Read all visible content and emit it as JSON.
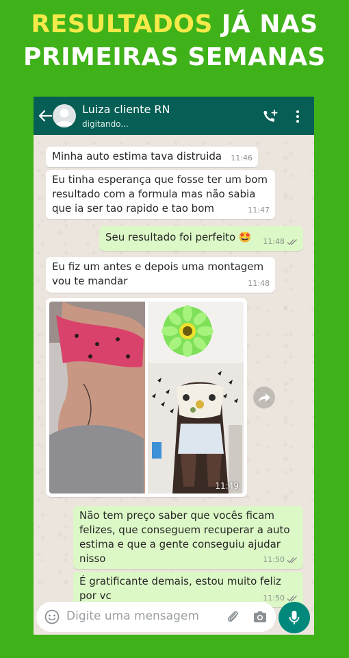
{
  "headline": {
    "accent": "RESULTADOS",
    "line1_rest": " JÁ NAS",
    "line2": "PRIMEIRAS SEMANAS"
  },
  "header": {
    "contact_name": "Luiza cliente RN",
    "status": "digitando...",
    "icons": [
      "back-arrow-icon",
      "avatar",
      "add-call-icon",
      "more-vert-icon"
    ]
  },
  "messages": [
    {
      "direction": "in",
      "text": "Minha auto estima tava distruida",
      "time": "11:46"
    },
    {
      "direction": "in",
      "text": "Eu tinha esperança que fosse ter um bom\nresultado com a formula mas não sabia\nque ia ser tao rapido e tao bom",
      "time": "11:47"
    },
    {
      "direction": "out",
      "text": "Seu resultado foi perfeito 🤩",
      "time": "11:48",
      "read": true
    },
    {
      "direction": "in",
      "text": "Eu fiz um antes e depois uma montagem\nvou te mandar",
      "time": "11:48"
    },
    {
      "direction": "in",
      "type": "image",
      "time": "11:49"
    },
    {
      "direction": "out",
      "text": "Não tem preço saber que vocês ficam\nfelizes, que conseguem recuperar a auto\nestima e que a gente conseguiu ajudar\nnisso",
      "time": "11:50",
      "read": true
    },
    {
      "direction": "out",
      "text": "É gratificante demais, estou muito feliz\npor vc",
      "time": "11:50",
      "read": true
    }
  ],
  "input": {
    "placeholder": "Digite uma mensagem"
  },
  "colors": {
    "page_bg": "#3fb219",
    "headline_accent": "#f6e94a",
    "header_bg": "#075e54",
    "chat_bg": "#ece5dd",
    "bubble_out": "#dcf8c6",
    "bubble_in": "#ffffff",
    "mic_button": "#00897b"
  }
}
